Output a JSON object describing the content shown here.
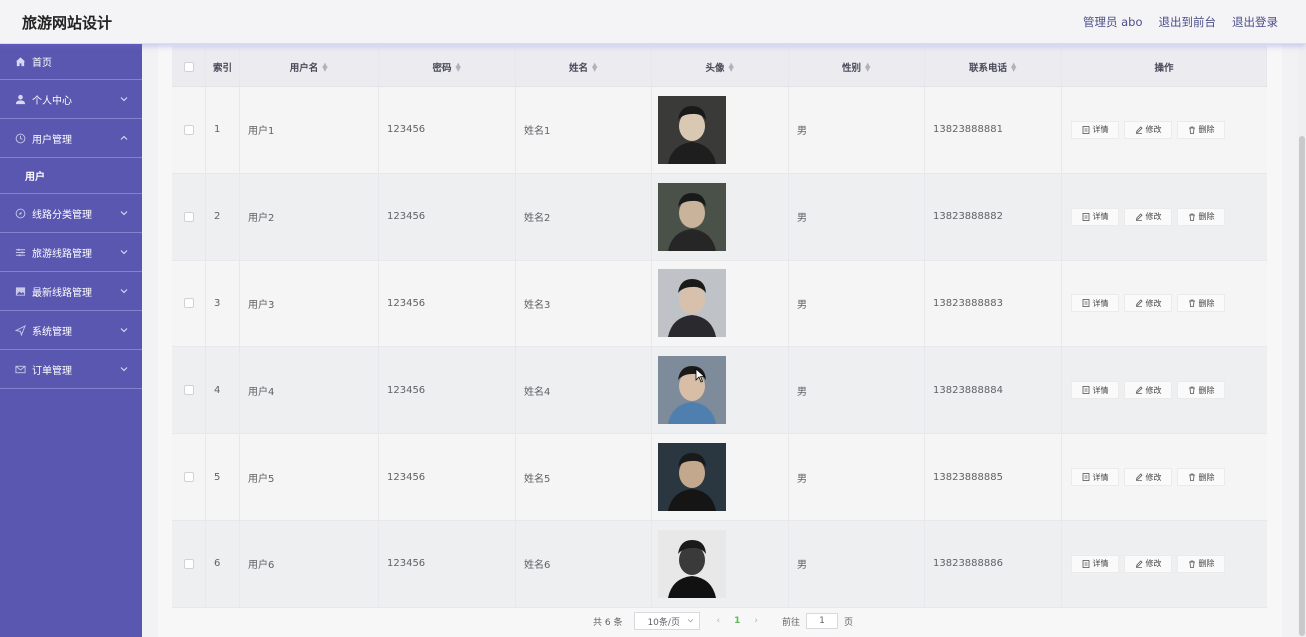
{
  "header": {
    "title": "旅游网站设计",
    "admin": "管理员 abo",
    "front": "退出到前台",
    "logout": "退出登录"
  },
  "sidebar": {
    "items": [
      {
        "label": "首页",
        "icon": "home-icon"
      },
      {
        "label": "个人中心",
        "icon": "user-icon"
      },
      {
        "label": "用户管理",
        "icon": "clock-icon",
        "expanded": true
      },
      {
        "label": "用户"
      },
      {
        "label": "线路分类管理",
        "icon": "compass-icon"
      },
      {
        "label": "旅游线路管理",
        "icon": "sliders-icon"
      },
      {
        "label": "最新线路管理",
        "icon": "image-icon"
      },
      {
        "label": "系统管理",
        "icon": "send-icon"
      },
      {
        "label": "订单管理",
        "icon": "mail-icon"
      }
    ]
  },
  "table": {
    "headers": [
      "索引",
      "用户名",
      "密码",
      "姓名",
      "头像",
      "性别",
      "联系电话",
      "操作"
    ],
    "rows": [
      {
        "idx": "1",
        "user": "用户1",
        "pwd": "123456",
        "name": "姓名1",
        "sex": "男",
        "tel": "13823888881"
      },
      {
        "idx": "2",
        "user": "用户2",
        "pwd": "123456",
        "name": "姓名2",
        "sex": "男",
        "tel": "13823888882"
      },
      {
        "idx": "3",
        "user": "用户3",
        "pwd": "123456",
        "name": "姓名3",
        "sex": "男",
        "tel": "13823888883"
      },
      {
        "idx": "4",
        "user": "用户4",
        "pwd": "123456",
        "name": "姓名4",
        "sex": "男",
        "tel": "13823888884"
      },
      {
        "idx": "5",
        "user": "用户5",
        "pwd": "123456",
        "name": "姓名5",
        "sex": "男",
        "tel": "13823888885"
      },
      {
        "idx": "6",
        "user": "用户6",
        "pwd": "123456",
        "name": "姓名6",
        "sex": "男",
        "tel": "13823888886"
      }
    ],
    "ops": {
      "detail": "详情",
      "edit": "修改",
      "delete": "删除"
    }
  },
  "pager": {
    "total": "共 6 条",
    "size": "10条/页",
    "page": "1",
    "goto": "前往",
    "goto_value": "1",
    "unit": "页"
  },
  "colors": {
    "sidebar": "#5a57b0",
    "accent": "#5cb85c"
  }
}
